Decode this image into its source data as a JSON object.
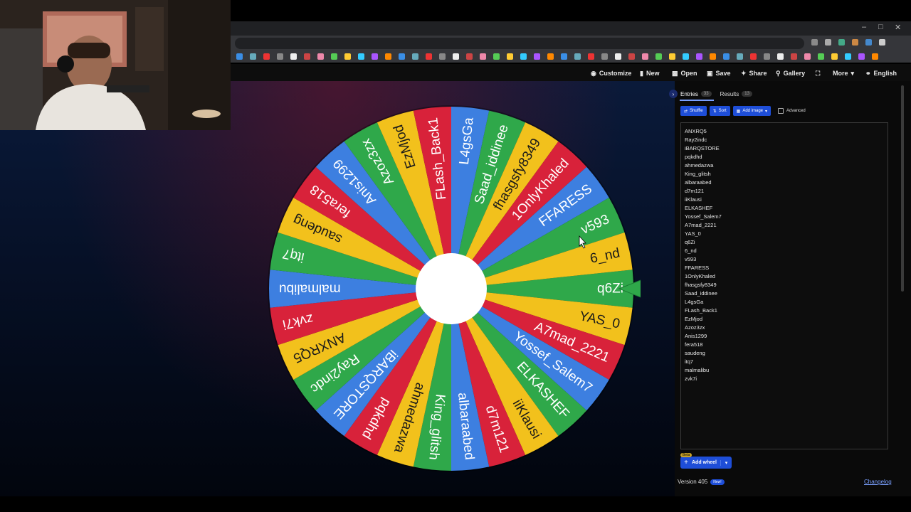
{
  "header": {
    "customize": "Customize",
    "new": "New",
    "open": "Open",
    "save": "Save",
    "share": "Share",
    "gallery": "Gallery",
    "more": "More",
    "language": "English"
  },
  "tabs": {
    "entries_label": "Entries",
    "entries_count": "33",
    "results_label": "Results",
    "results_count": "13"
  },
  "tools": {
    "shuffle": "Shuffle",
    "sort": "Sort",
    "add_image": "Add image",
    "advanced": "Advanced"
  },
  "entries": [
    "ANXRQ5",
    "Ray2indc",
    "iBARQSTORE",
    "pqkdhd",
    "ahmedazwa",
    "King_glitsh",
    "albaraabed",
    "d7m121",
    "iiKlausi",
    "ELKASHEF",
    "Yossef_Salem7",
    "A7mad_2221",
    "YAS_0",
    "q6Zi",
    "6_nd",
    "v593",
    "FFARESS",
    "1OnlyKhaled",
    "fhasgsfy8349",
    "Saad_iddinee",
    "L4gsGa",
    "FLash_Back1",
    "EzMjod",
    "Azoz3zx",
    "Anis1299",
    "fera518",
    "saudeng",
    "itq7",
    "malmalibu",
    "zvk7i"
  ],
  "wheel": {
    "slices": [
      "q6Zi",
      "YAS_0",
      "A7mad_2221",
      "Yossef_Salem7",
      "ELKASHEF",
      "iiKlausi",
      "d7m121",
      "albaraabed",
      "King_glitsh",
      "ahmedazwa",
      "pqkdhd",
      "iBARQSTORE",
      "Ray2indc",
      "ANXRQ5",
      "zvk7i",
      "malmalibu",
      "itq7",
      "saudeng",
      "fera518",
      "Anis1299",
      "Azoz3zx",
      "EzMjod",
      "FLash_Back1",
      "L4gsGa",
      "Saad_iddinee",
      "fhasgsfy8349",
      "1OnlyKhaled",
      "FFARESS",
      "v593",
      "6_nd"
    ],
    "colors": [
      "#2fa84a",
      "#f2c11c",
      "#d8223a",
      "#3d7fe0"
    ],
    "pointer_color": "#2fa84a"
  },
  "footer": {
    "beta": "Beta",
    "add_wheel": "Add wheel",
    "version": "Version 405",
    "new_badge": "New!",
    "changelog": "Changelog"
  }
}
